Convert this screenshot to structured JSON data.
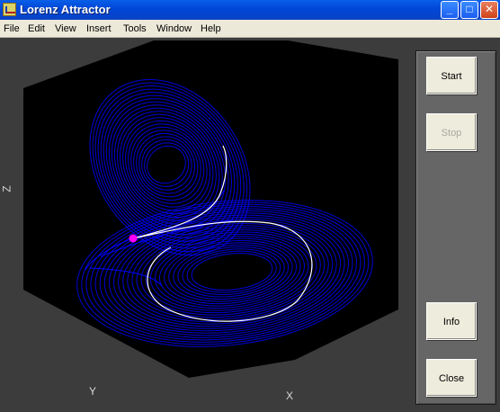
{
  "window": {
    "title": "Lorenz Attractor",
    "controls": {
      "minimize": "_",
      "maximize": "□",
      "close": "✕"
    }
  },
  "menu": [
    "File",
    "Edit",
    "View",
    "Insert",
    "Tools",
    "Window",
    "Help"
  ],
  "plot": {
    "axis_labels": {
      "x": "X",
      "y": "Y",
      "z": "Z"
    },
    "colors": {
      "background": "#000000",
      "trajectory": "#0000ff",
      "highlight": "#ffffff",
      "marker": "#ff00ff"
    }
  },
  "panel": {
    "buttons": {
      "start": "Start",
      "stop": "Stop",
      "info": "Info",
      "close": "Close"
    },
    "stop_enabled": false
  },
  "icons": {
    "app": "matlab-figure-icon"
  }
}
